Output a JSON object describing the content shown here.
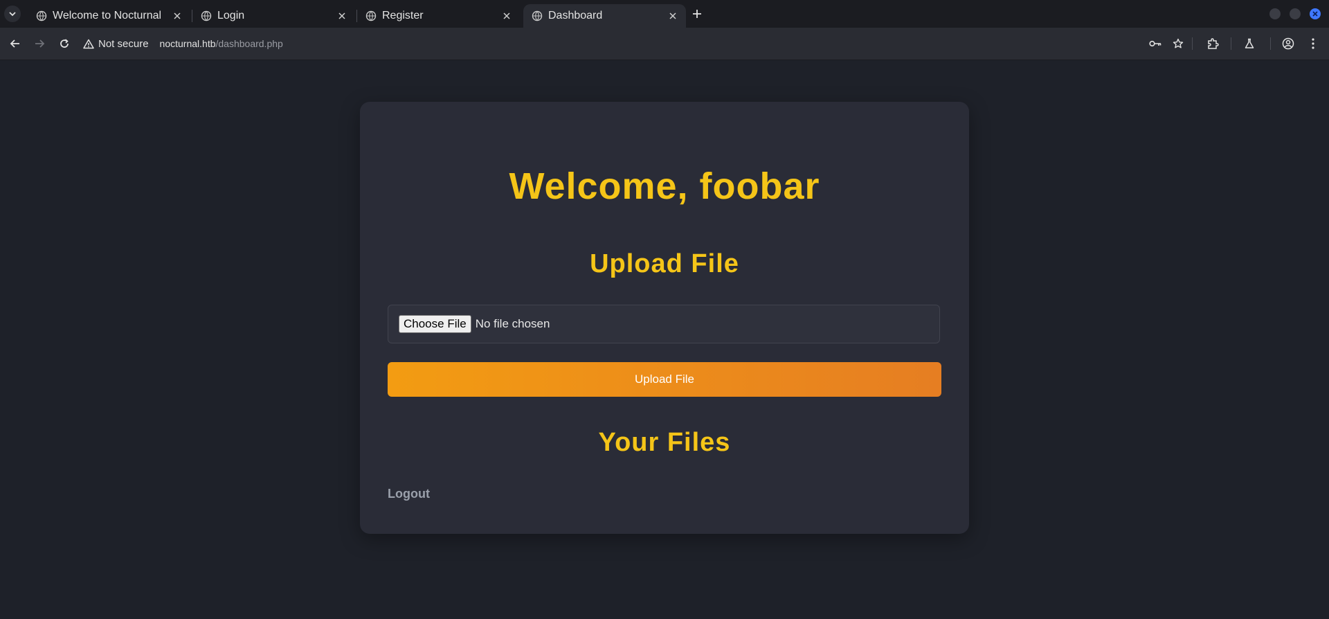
{
  "browser": {
    "tabs": [
      {
        "title": "Welcome to Nocturnal",
        "active": false
      },
      {
        "title": "Login",
        "active": false
      },
      {
        "title": "Register",
        "active": false
      },
      {
        "title": "Dashboard",
        "active": true
      }
    ],
    "security_label": "Not secure",
    "url_host": "nocturnal.htb",
    "url_path": "/dashboard.php"
  },
  "page": {
    "welcome": "Welcome, foobar",
    "upload_heading": "Upload File",
    "choose_file_label": "Choose File",
    "no_file_text": "No file chosen",
    "upload_button": "Upload File",
    "files_heading": "Your Files",
    "logout_label": "Logout"
  },
  "colors": {
    "heading": "#f5c518",
    "button_gradient_start": "#f39c12",
    "button_gradient_end": "#e67e22",
    "card_bg": "#2a2c37",
    "page_bg": "#1e2129"
  }
}
